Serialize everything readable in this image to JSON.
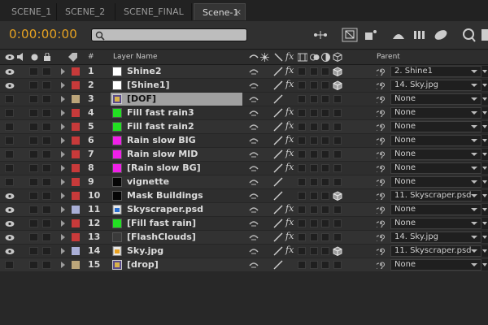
{
  "tabs": [
    {
      "label": "SCENE_1",
      "active": false
    },
    {
      "label": "SCENE_2",
      "active": false
    },
    {
      "label": "SCENE_FINAL",
      "active": false
    },
    {
      "label": "Scene-1",
      "active": true
    }
  ],
  "close_glyph": "×",
  "toolbar": {
    "timecode": "0:00:00:00",
    "search_placeholder": "",
    "icons": [
      "composition-mini-flowchart-icon",
      "draft-3d-icon",
      "comp-marker-icon",
      "frame-blending-icon",
      "motion-blur-icon",
      "graph-editor-icon"
    ]
  },
  "columns": {
    "number": "#",
    "layer_name": "Layer Name",
    "parent": "Parent"
  },
  "colors": {
    "accent_timecode": "#e8a321",
    "label_red": "#c83a3a",
    "label_tan": "#bba57a",
    "label_lavender": "#a9aed6"
  },
  "layers": [
    {
      "num": "1",
      "name": "Shine2",
      "label": "#c83a3a",
      "src": "solid-white",
      "parent": "2. Shine1",
      "fx": true,
      "cube": true,
      "selected": false
    },
    {
      "num": "2",
      "name": "[Shine1]",
      "label": "#c83a3a",
      "src": "solid-white",
      "parent": "14. Sky.jpg",
      "fx": true,
      "cube": true,
      "selected": false
    },
    {
      "num": "3",
      "name": "[DOF]",
      "label": "#bba57a",
      "src": "precomp",
      "parent": "None",
      "fx": false,
      "cube": false,
      "selected": true
    },
    {
      "num": "4",
      "name": "Fill fast rain3",
      "label": "#c83a3a",
      "src": "solid-green",
      "parent": "None",
      "fx": true,
      "cube": false,
      "selected": false
    },
    {
      "num": "5",
      "name": "Fill fast rain2",
      "label": "#c83a3a",
      "src": "solid-green",
      "parent": "None",
      "fx": true,
      "cube": false,
      "selected": false
    },
    {
      "num": "6",
      "name": "Rain slow BIG",
      "label": "#c83a3a",
      "src": "solid-magenta",
      "parent": "None",
      "fx": true,
      "cube": false,
      "selected": false
    },
    {
      "num": "7",
      "name": "Rain slow MID",
      "label": "#c83a3a",
      "src": "solid-magenta",
      "parent": "None",
      "fx": true,
      "cube": false,
      "selected": false
    },
    {
      "num": "8",
      "name": "[Rain slow BG]",
      "label": "#c83a3a",
      "src": "solid-magenta",
      "parent": "None",
      "fx": true,
      "cube": false,
      "selected": false
    },
    {
      "num": "9",
      "name": "vignette",
      "label": "#c83a3a",
      "src": "solid-black",
      "parent": "None",
      "fx": false,
      "cube": false,
      "selected": false
    },
    {
      "num": "10",
      "name": "Mask Buildings",
      "label": "#c83a3a",
      "src": "solid-black",
      "parent": "11. Skyscraper.psd",
      "fx": false,
      "cube": true,
      "selected": false
    },
    {
      "num": "11",
      "name": "Skyscraper.psd",
      "label": "#a9aed6",
      "src": "psd",
      "parent": "None",
      "fx": true,
      "cube": false,
      "selected": false
    },
    {
      "num": "12",
      "name": "[Fill fast rain]",
      "label": "#c83a3a",
      "src": "solid-green",
      "parent": "None",
      "fx": true,
      "cube": false,
      "selected": false
    },
    {
      "num": "13",
      "name": "[FlashClouds]",
      "label": "#c83a3a",
      "src": "solid-grey",
      "parent": "14. Sky.jpg",
      "fx": true,
      "cube": false,
      "selected": false
    },
    {
      "num": "14",
      "name": "Sky.jpg",
      "label": "#a9aed6",
      "src": "jpg",
      "parent": "11. Skyscraper.psd",
      "fx": true,
      "cube": true,
      "selected": false
    },
    {
      "num": "15",
      "name": "[drop]",
      "label": "#bba57a",
      "src": "precomp",
      "parent": "None",
      "fx": false,
      "cube": false,
      "selected": false
    }
  ]
}
